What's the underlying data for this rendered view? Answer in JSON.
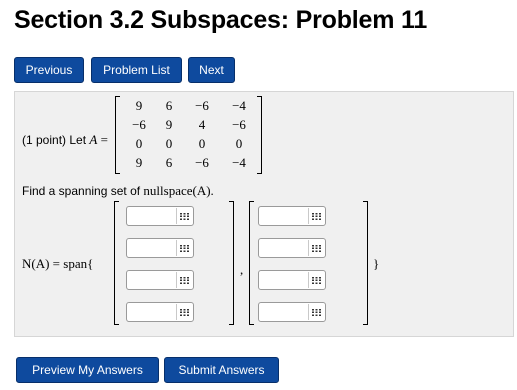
{
  "page": {
    "title": "Section 3.2 Subspaces: Problem 11"
  },
  "nav": {
    "previous": "Previous",
    "problem_list": "Problem List",
    "next": "Next"
  },
  "problem": {
    "prefix": "(1 point) Let ",
    "var": "A",
    "eq": " =",
    "matrix": [
      [
        "9",
        "6",
        "−6",
        "−4"
      ],
      [
        "−6",
        "9",
        "4",
        "−6"
      ],
      [
        "0",
        "0",
        "0",
        "0"
      ],
      [
        "9",
        "6",
        "−6",
        "−4"
      ]
    ],
    "question_text": "Find a spanning set of ",
    "question_math": "nullspace(A).",
    "span_label": "N(A) = span{",
    "comma": ",",
    "close_brace": "}",
    "vectors": [
      [
        "",
        "",
        "",
        ""
      ],
      [
        "",
        "",
        "",
        ""
      ]
    ]
  },
  "actions": {
    "preview": "Preview My Answers",
    "submit": "Submit Answers"
  },
  "icons": {
    "input_helper": "matrix-grid-icon"
  }
}
